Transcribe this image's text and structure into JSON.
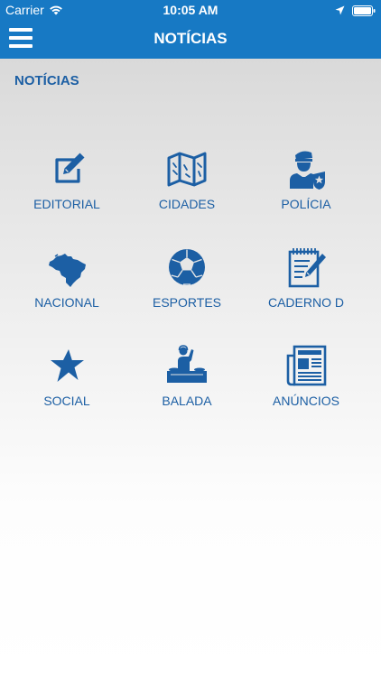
{
  "status_bar": {
    "carrier": "Carrier",
    "time": "10:05 AM"
  },
  "nav": {
    "title": "NOTÍCIAS"
  },
  "section": {
    "title": "NOTÍCIAS"
  },
  "colors": {
    "brand": "#1779c4",
    "icon": "#1c5fa4",
    "text": "#1c5fa4"
  },
  "menu": [
    {
      "label": "EDITORIAL",
      "icon": "edit-icon"
    },
    {
      "label": "CIDADES",
      "icon": "map-icon"
    },
    {
      "label": "POLÍCIA",
      "icon": "police-icon"
    },
    {
      "label": "NACIONAL",
      "icon": "brazil-map-icon"
    },
    {
      "label": "ESPORTES",
      "icon": "soccer-ball-icon"
    },
    {
      "label": "CADERNO D",
      "icon": "notepad-pencil-icon"
    },
    {
      "label": "SOCIAL",
      "icon": "star-icon"
    },
    {
      "label": "BALADA",
      "icon": "dj-icon"
    },
    {
      "label": "ANÚNCIOS",
      "icon": "newspaper-icon"
    }
  ]
}
